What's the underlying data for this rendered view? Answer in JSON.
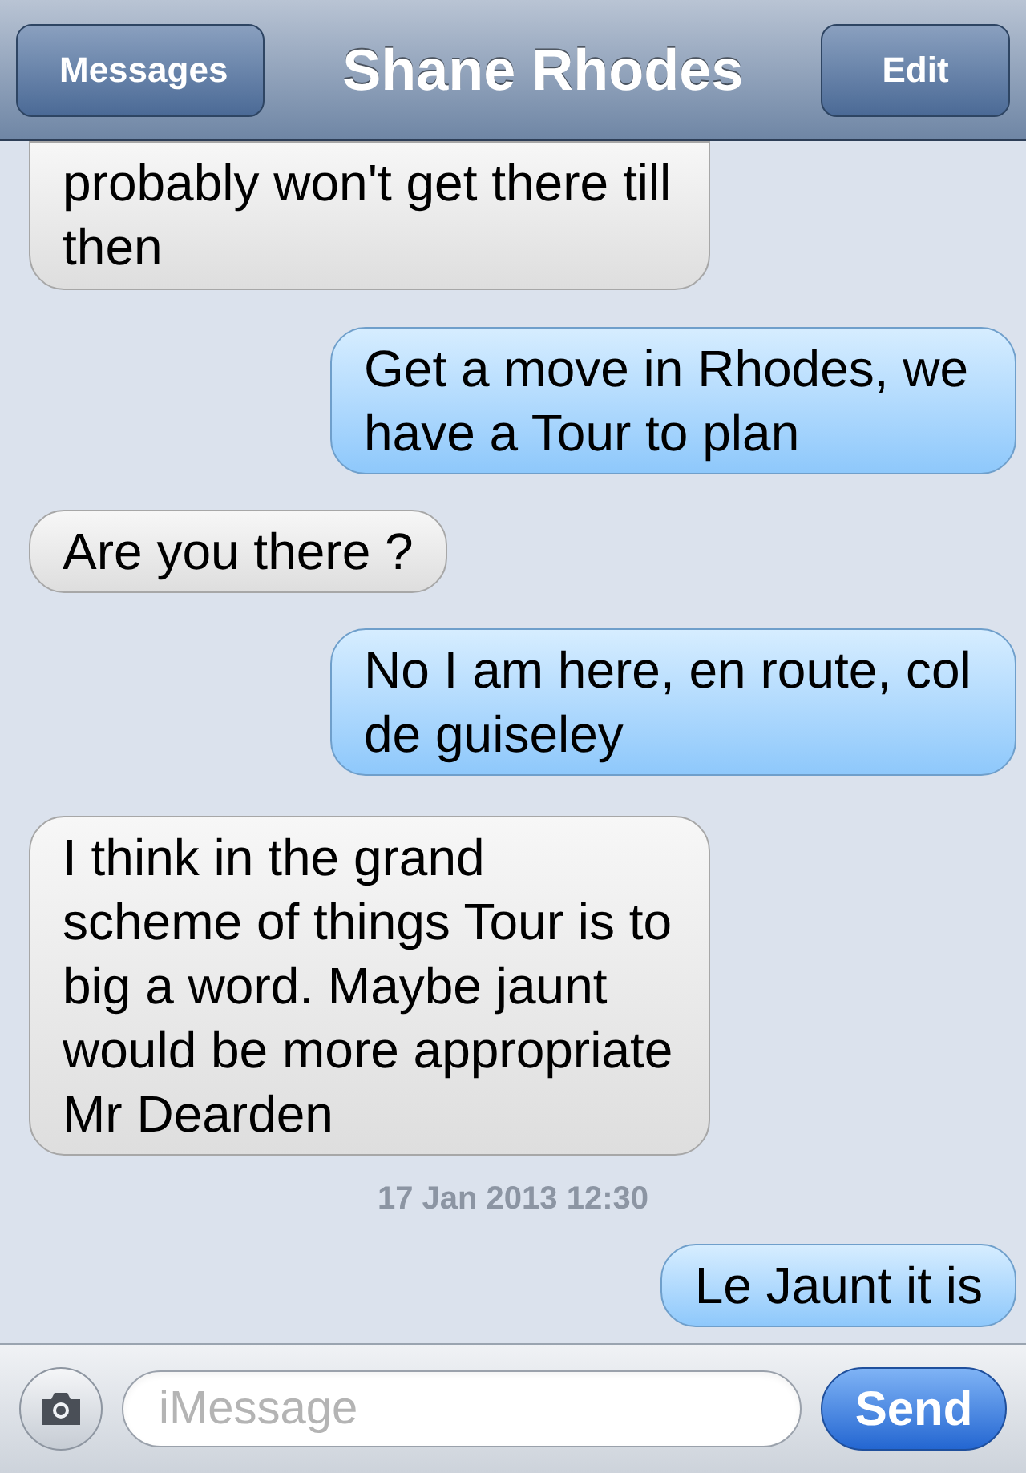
{
  "nav": {
    "back_button": "Messages",
    "title": "Shane Rhodes",
    "edit_button": "Edit"
  },
  "messages": [
    {
      "kind": "received",
      "text": "probably won't get there till then",
      "clipped": true
    },
    {
      "kind": "sent",
      "text": "Get a move in Rhodes, we have a Tour to plan",
      "clipped": false
    },
    {
      "kind": "received",
      "text": "Are you there ?",
      "clipped": false
    },
    {
      "kind": "sent",
      "text": "No I am here, en route, col de guiseley",
      "clipped": false
    },
    {
      "kind": "received",
      "text": "I think in the grand scheme of things Tour is to big a word. Maybe jaunt would be more appropriate Mr Dearden",
      "clipped": false
    },
    {
      "kind": "timestamp",
      "text": "17 Jan 2013 12:30"
    },
    {
      "kind": "sent",
      "text": "Le Jaunt it is",
      "clipped": false
    }
  ],
  "composer": {
    "placeholder": "iMessage",
    "send_button": "Send"
  }
}
